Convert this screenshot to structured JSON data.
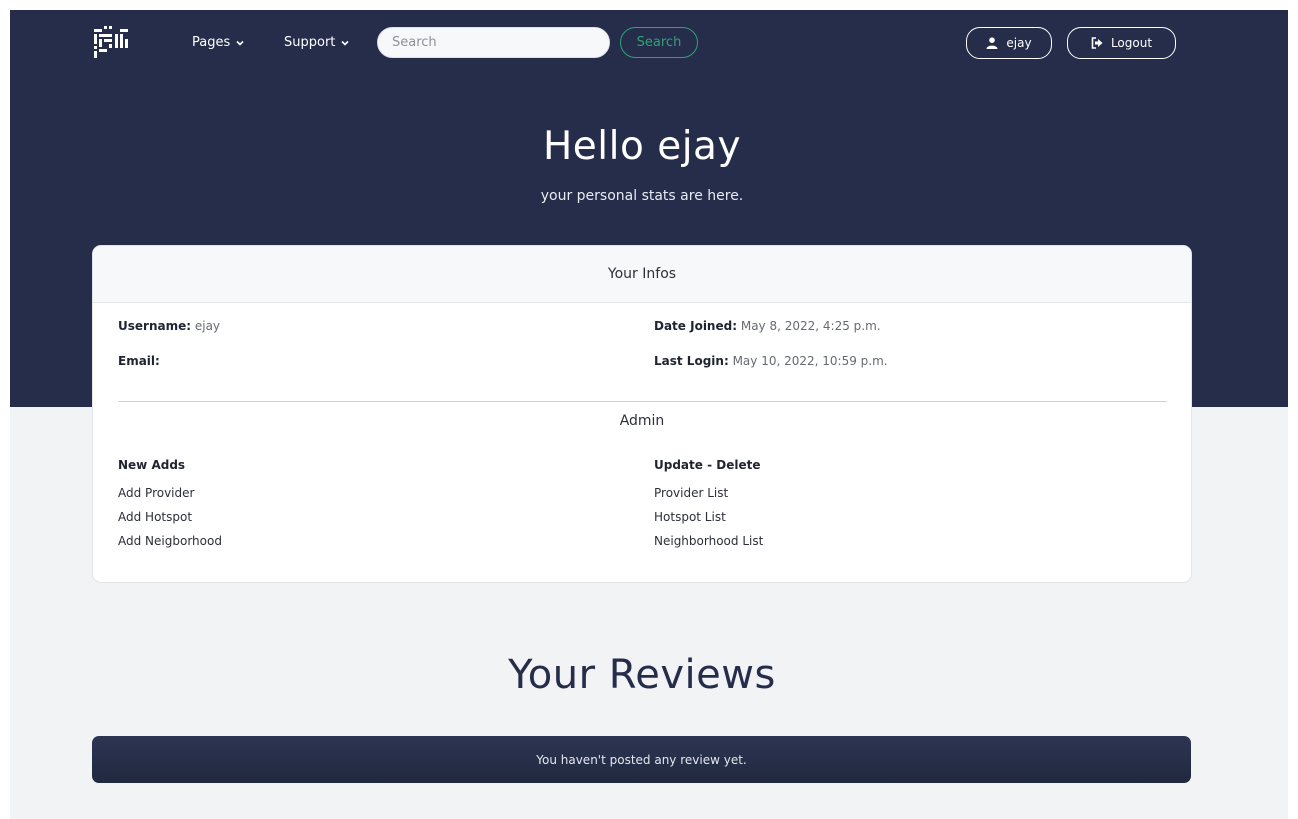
{
  "nav": {
    "pages_label": "Pages",
    "support_label": "Support",
    "search_placeholder": "Search",
    "search_button": "Search",
    "user_label": "ejay",
    "logout_label": "Logout"
  },
  "hero": {
    "title": "Hello ejay",
    "subtitle": "your personal stats are here."
  },
  "infos": {
    "header": "Your Infos",
    "username_label": "Username:",
    "username_value": "ejay",
    "email_label": "Email:",
    "email_value": "",
    "date_joined_label": "Date Joined:",
    "date_joined_value": "May 8, 2022, 4:25 p.m.",
    "last_login_label": "Last Login:",
    "last_login_value": "May 10, 2022, 10:59 p.m."
  },
  "admin": {
    "title": "Admin",
    "new_adds_header": "New Adds",
    "new_adds": [
      "Add Provider",
      "Add Hotspot",
      "Add Neigborhood"
    ],
    "update_header": "Update - Delete",
    "update": [
      "Provider List",
      "Hotspot List",
      "Neighborhood List"
    ]
  },
  "reviews": {
    "title": "Your Reviews",
    "empty_message": "You haven't posted any review yet."
  },
  "colors": {
    "hero_bg": "#252d4b",
    "page_bg": "#f2f3f5",
    "accent_green": "#2fa378"
  }
}
